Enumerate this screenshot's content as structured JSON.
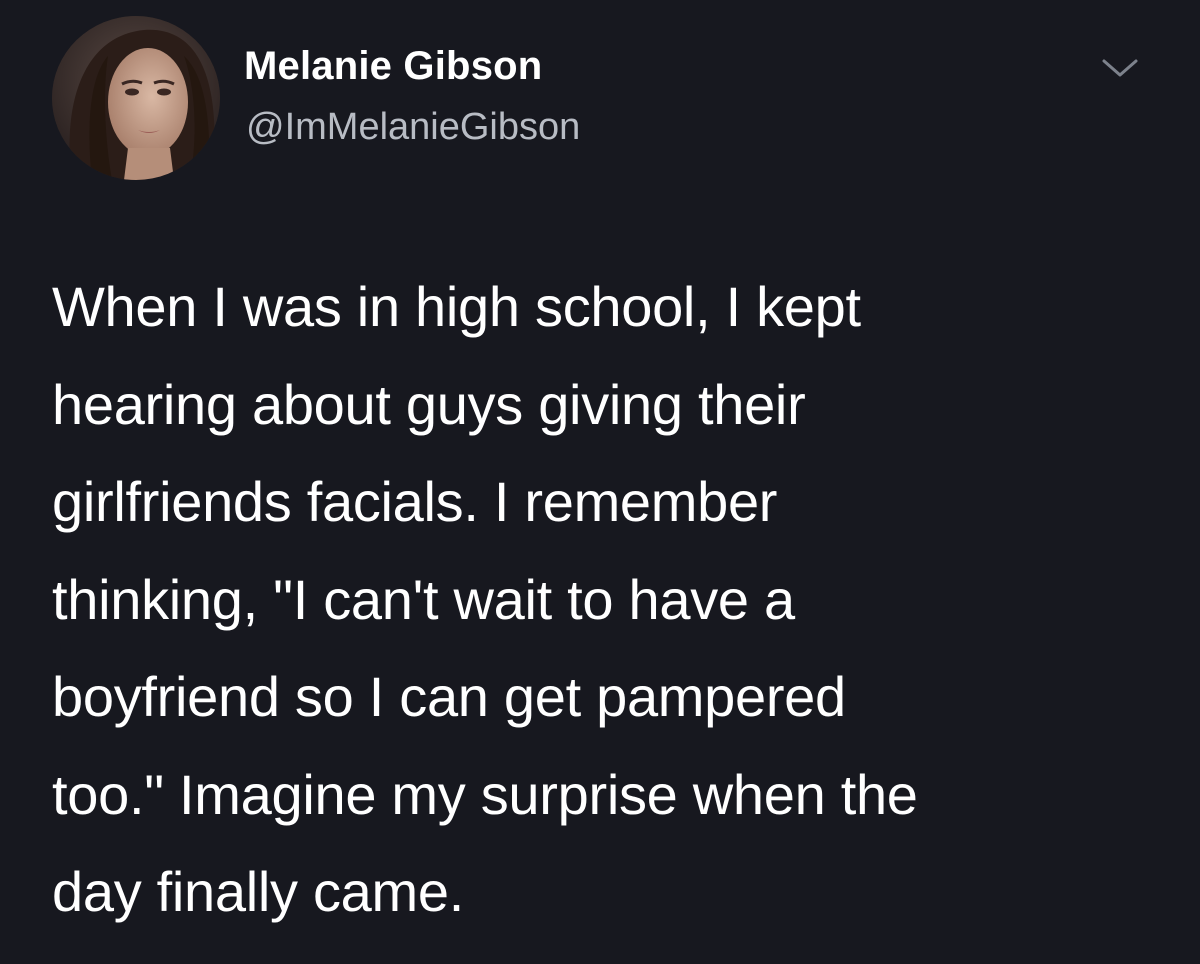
{
  "author": {
    "display_name": "Melanie Gibson",
    "handle": "@ImMelanieGibson",
    "avatar_icon": "profile-photo"
  },
  "menu": {
    "icon": "chevron-down-icon"
  },
  "tweet": {
    "lines": [
      "When I was in high school, I kept",
      "hearing about guys giving their",
      "girlfriends facials. I remember",
      "thinking, \"I can't wait to have a",
      "boyfriend so I can get pampered",
      "too.\" Imagine my surprise when the",
      "day finally came."
    ]
  },
  "colors": {
    "background": "#17181f",
    "text": "#ffffff",
    "secondary_text": "#b8bcc4"
  }
}
